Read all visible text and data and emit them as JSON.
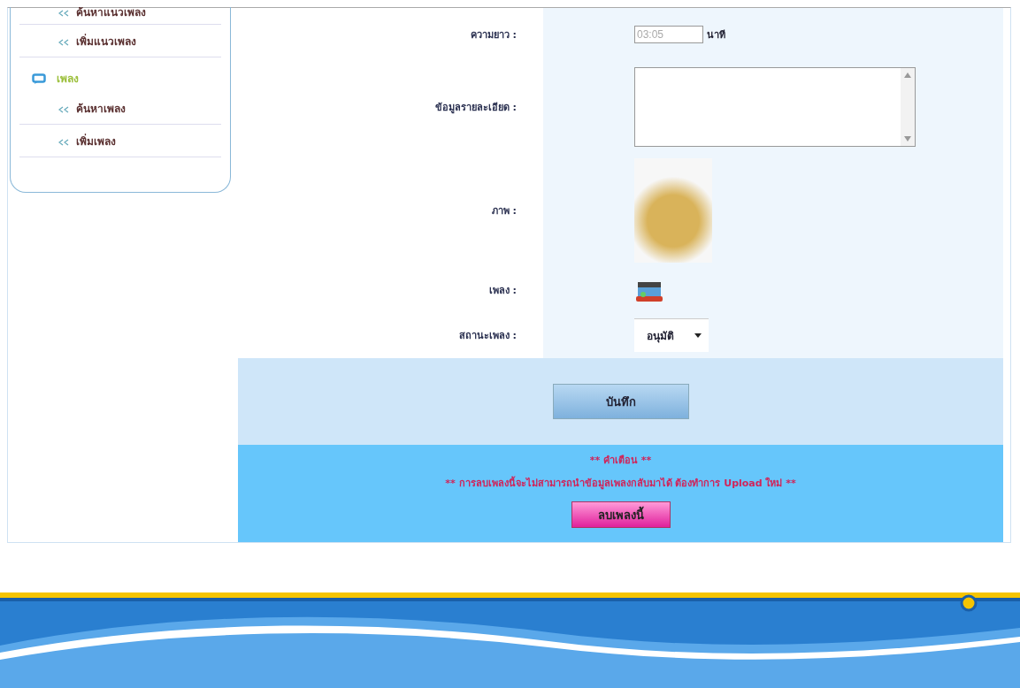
{
  "sidebar": {
    "sections": [
      {
        "items": [
          {
            "label": "ค้นหาแนวเพลง"
          },
          {
            "label": "เพิ่มแนวเพลง"
          }
        ]
      },
      {
        "title": "เพลง",
        "items": [
          {
            "label": "ค้นหาเพลง"
          },
          {
            "label": "เพิ่มเพลง"
          }
        ]
      }
    ]
  },
  "form": {
    "rows": [
      {
        "kind": "duration",
        "label": "ความยาว :",
        "value": "03:05",
        "unit": "นาที"
      },
      {
        "kind": "textarea",
        "label": "ข้อมูลรายละเอียด :"
      },
      {
        "kind": "image",
        "label": "ภาพ :"
      },
      {
        "kind": "file",
        "label": "เพลง :"
      },
      {
        "kind": "select",
        "label": "สถานะเพลง :",
        "value": "อนุมัติ"
      }
    ],
    "save_button": "บันทึก"
  },
  "warning": {
    "title": "** คำเตือน **",
    "message": "** การลบเพลงนี้จะไม่สามารถนำข้อมูลเพลงกลับมาได้ ต้องทำการ Upload ใหม่ **",
    "delete_button": "ลบเพลงนี้"
  }
}
